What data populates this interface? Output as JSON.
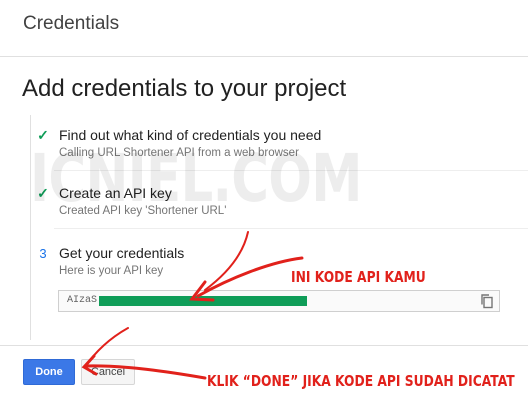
{
  "header": {
    "title": "Credentials"
  },
  "page": {
    "heading": "Add credentials to your project"
  },
  "steps": [
    {
      "marker": "✓",
      "label": "Find out what kind of credentials you need",
      "sub": "Calling URL Shortener API from a web browser"
    },
    {
      "marker": "✓",
      "label": "Create an API key",
      "sub": "Created API key 'Shortener URL'"
    },
    {
      "marker": "3",
      "label": "Get your credentials",
      "sub": "Here is your API key"
    }
  ],
  "api_key": {
    "visible_prefix": "AIzaS"
  },
  "buttons": {
    "done": "Done",
    "cancel": "Cancel"
  },
  "watermark": "ICNIEL.COM",
  "annotations": {
    "api_key_note": "INI KODE API KAMU",
    "done_note": "KLIK “DONE” JIKA KODE API SUDAH DICATAT"
  },
  "colors": {
    "check": "#0f9d58",
    "primary": "#3b78e7",
    "annotation": "#e1211b",
    "redaction": "#0f9d58"
  }
}
